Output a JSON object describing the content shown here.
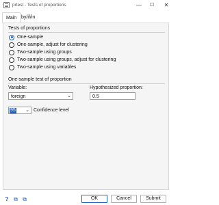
{
  "window": {
    "title": "prtest - Tests of proportions",
    "minimize_glyph": "—",
    "maximize_glyph": "☐",
    "close_glyph": "✕"
  },
  "tabs": [
    {
      "label": "Main",
      "active": true
    },
    {
      "label": "by/if/in",
      "active": false
    }
  ],
  "tests_section": {
    "title": "Tests of proportions",
    "options": [
      {
        "label": "One-sample",
        "checked": true
      },
      {
        "label": "One-sample, adjust for clustering",
        "checked": false
      },
      {
        "label": "Two-sample using groups",
        "checked": false
      },
      {
        "label": "Two-sample using groups, adjust for clustering",
        "checked": false
      },
      {
        "label": "Two-sample using variables",
        "checked": false
      }
    ]
  },
  "one_sample": {
    "title": "One-sample test of proportion",
    "variable_label": "Variable:",
    "variable_value": "foreign",
    "hyp_label": "Hypothesized proportion:",
    "hyp_value": "0.5",
    "confidence_value": "95",
    "confidence_label": "Confidence level"
  },
  "footer": {
    "help_glyph": "?",
    "copy_glyph": "⧉",
    "submit_icon_glyph": "⧉",
    "ok_label": "OK",
    "cancel_label": "Cancel",
    "submit_label": "Submit"
  },
  "colors": {
    "accent": "#1f5fbf"
  }
}
